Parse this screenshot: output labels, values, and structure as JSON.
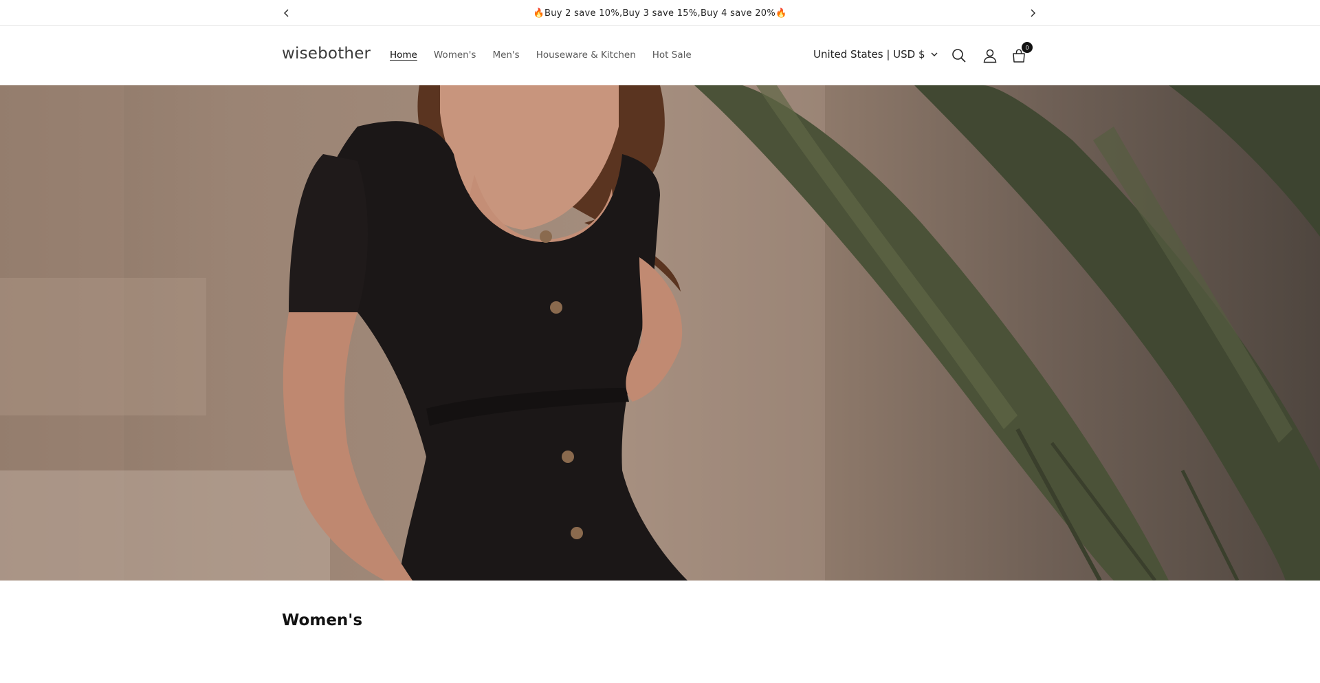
{
  "announcement": {
    "message": "🔥Buy 2 save 10%,Buy 3 save 15%,Buy 4 save 20%🔥"
  },
  "header": {
    "logo": "wisebother",
    "nav": [
      {
        "label": "Home",
        "active": true
      },
      {
        "label": "Women's",
        "active": false
      },
      {
        "label": "Men's",
        "active": false
      },
      {
        "label": "Houseware & Kitchen",
        "active": false
      },
      {
        "label": "Hot Sale",
        "active": false
      }
    ],
    "locale": "United States | USD $",
    "cart_count": "0",
    "icons": [
      "search-icon",
      "account-icon",
      "cart-icon",
      "chevron-down-icon"
    ]
  },
  "section": {
    "title": "Women's"
  },
  "colors": {
    "text": "#121212",
    "nav_muted": "#5a5a5a",
    "border": "#e6e6e6"
  }
}
